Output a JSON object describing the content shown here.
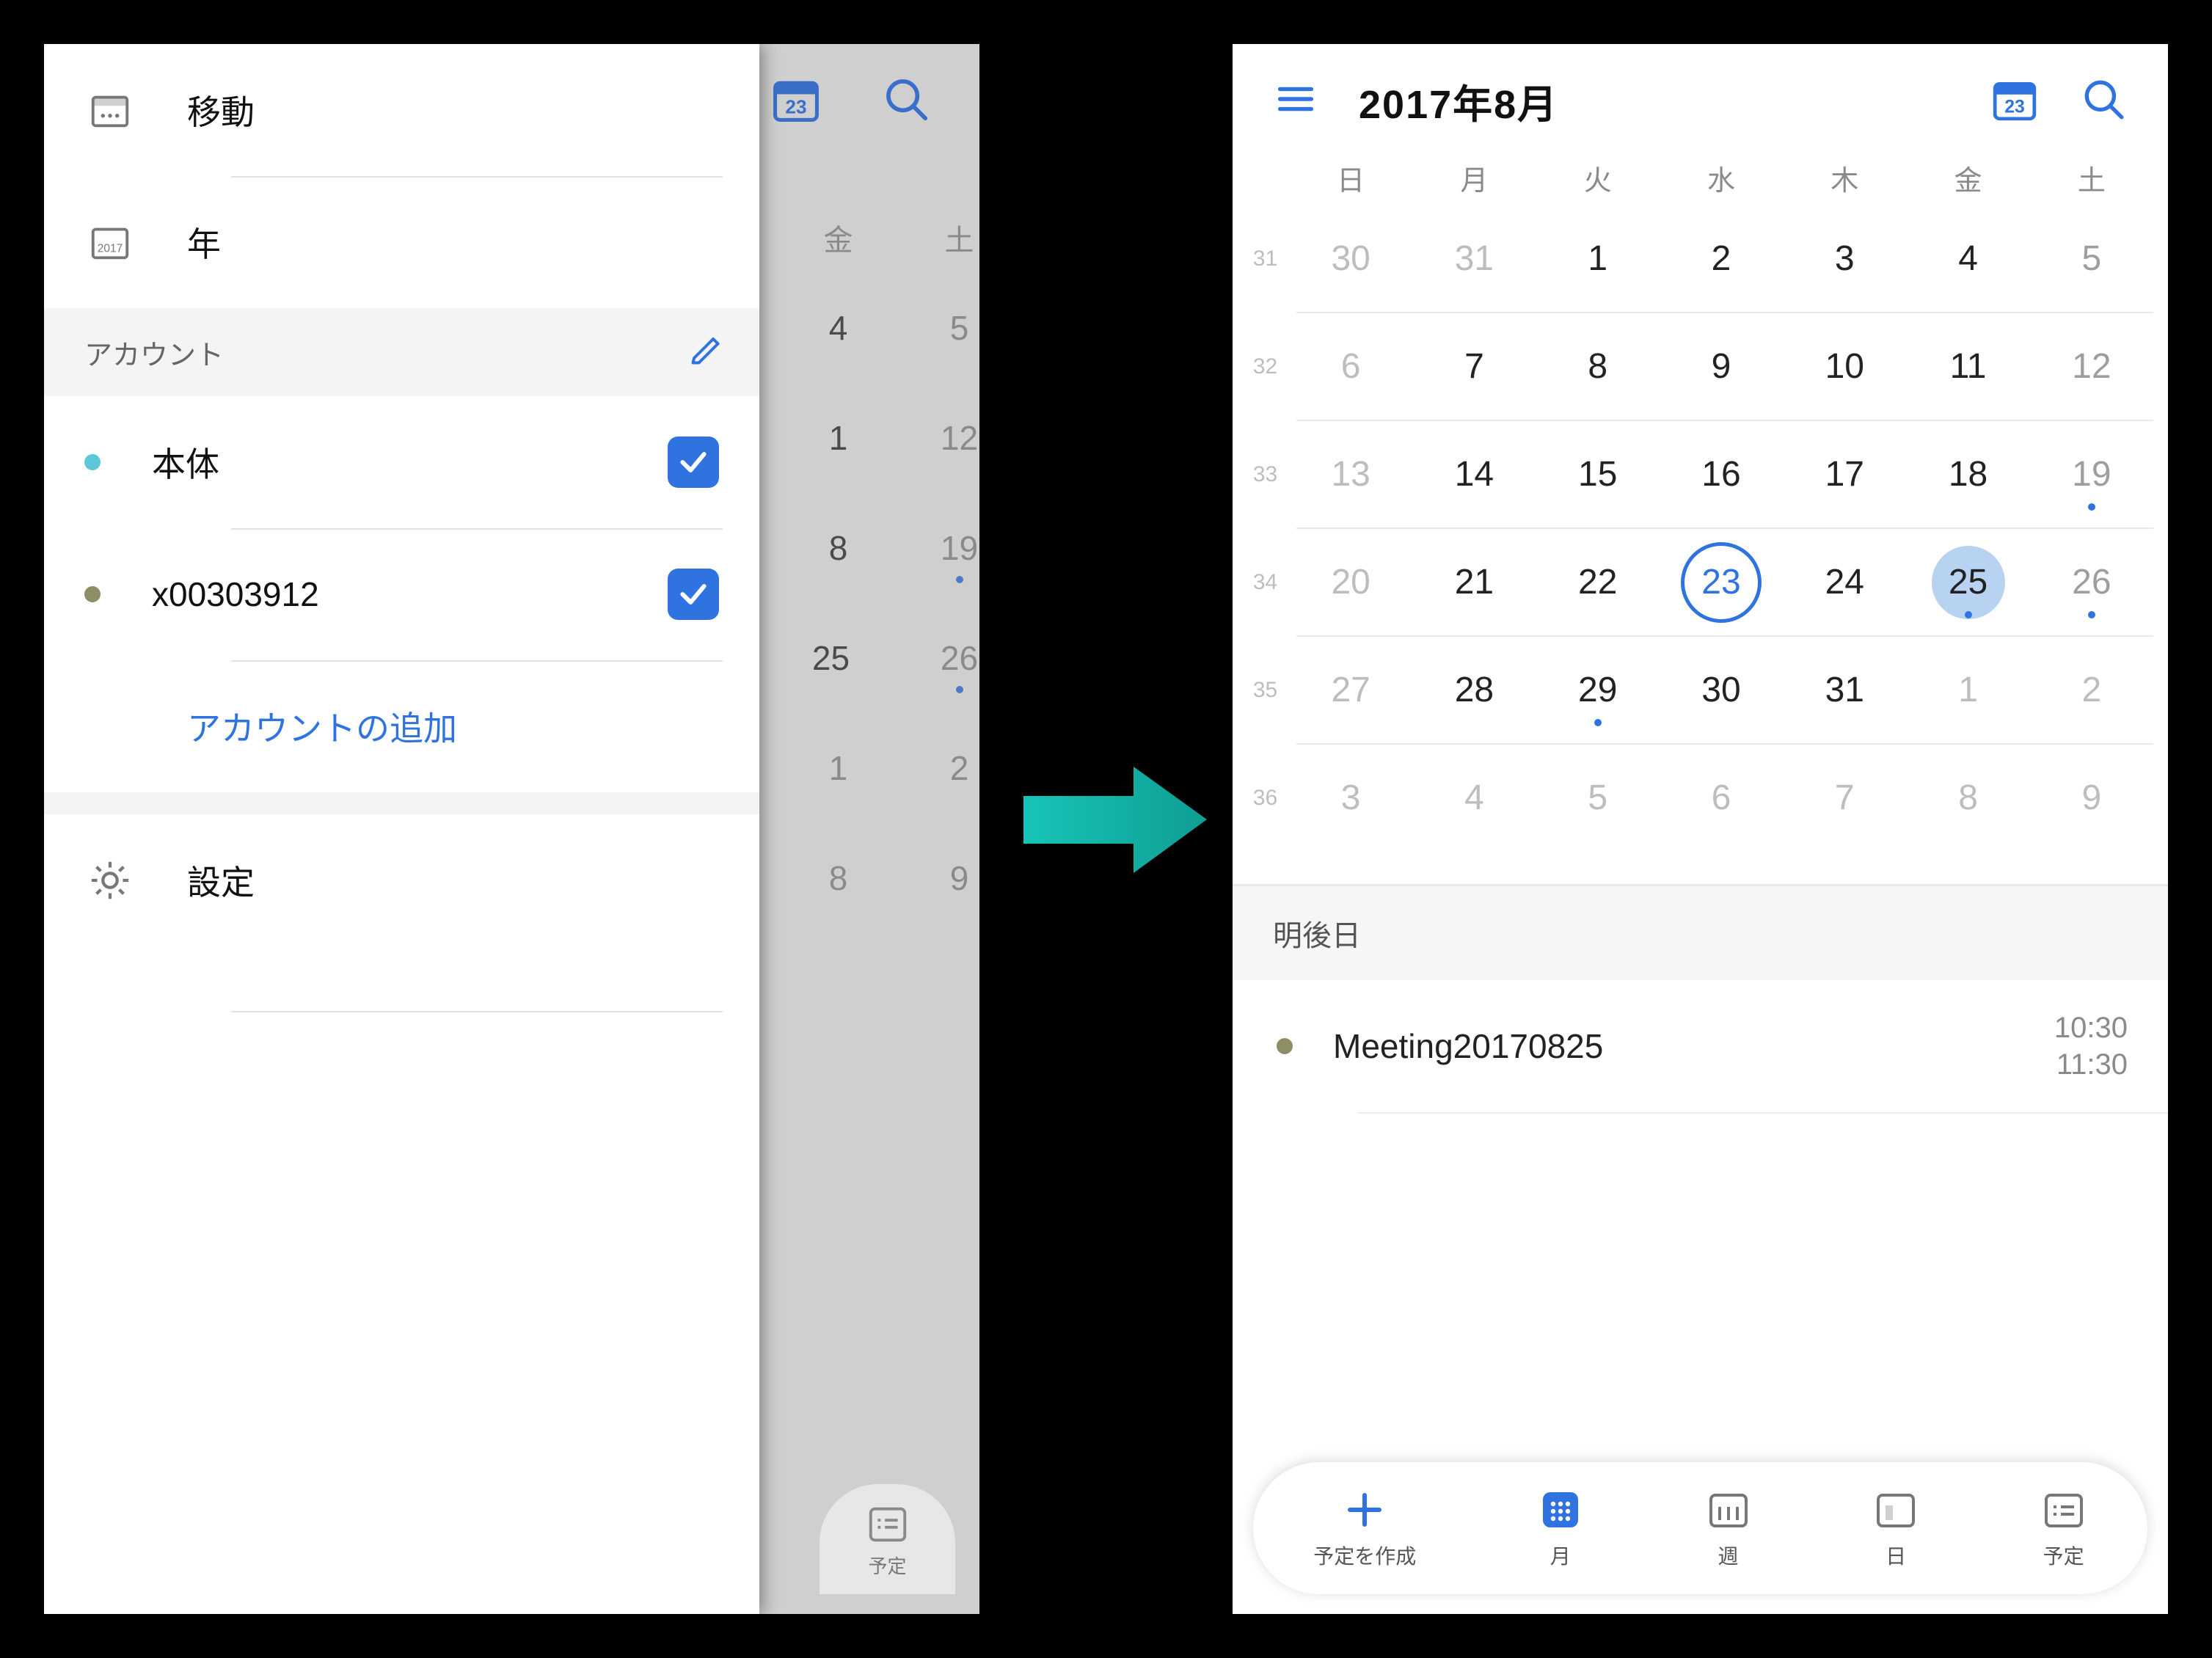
{
  "colors": {
    "accent": "#2f73e0",
    "muted": "#8a8a8a",
    "acc2": "#8d8d68",
    "acc3": "#5bc7d8"
  },
  "left": {
    "drawer": {
      "move": "移動",
      "year": "年",
      "accounts_header": "アカウント",
      "acct1": "本体",
      "acct2": "x00303912",
      "add_account": "アカウントの追加",
      "settings": "設定"
    },
    "underlay": {
      "fri": "金",
      "sat": "土",
      "cells": [
        {
          "fri": "4",
          "sat": "5"
        },
        {
          "fri": "1",
          "sat": "12"
        },
        {
          "fri": "8",
          "sat": "19",
          "dotSat": true
        },
        {
          "fri": "25",
          "sat": "26",
          "dotSat": true
        },
        {
          "fri": "1",
          "sat": "2"
        },
        {
          "fri": "8",
          "sat": "9"
        }
      ],
      "pill": "予定"
    }
  },
  "right": {
    "title": "2017年8月",
    "week_labels": [
      "日",
      "月",
      "火",
      "水",
      "木",
      "金",
      "土"
    ],
    "rows": [
      {
        "wk": "31",
        "d": [
          {
            "n": "30",
            "off": true
          },
          {
            "n": "31",
            "off": true
          },
          {
            "n": "1"
          },
          {
            "n": "2"
          },
          {
            "n": "3"
          },
          {
            "n": "4"
          },
          {
            "n": "5",
            "sat": true
          }
        ]
      },
      {
        "wk": "32",
        "d": [
          {
            "n": "6",
            "off": true
          },
          {
            "n": "7"
          },
          {
            "n": "8"
          },
          {
            "n": "9"
          },
          {
            "n": "10"
          },
          {
            "n": "11"
          },
          {
            "n": "12",
            "sat": true
          }
        ]
      },
      {
        "wk": "33",
        "d": [
          {
            "n": "13",
            "off": true
          },
          {
            "n": "14"
          },
          {
            "n": "15"
          },
          {
            "n": "16"
          },
          {
            "n": "17"
          },
          {
            "n": "18"
          },
          {
            "n": "19",
            "sat": true,
            "dot": true
          }
        ]
      },
      {
        "wk": "34",
        "d": [
          {
            "n": "20",
            "off": true
          },
          {
            "n": "21"
          },
          {
            "n": "22"
          },
          {
            "n": "23",
            "today": true
          },
          {
            "n": "24"
          },
          {
            "n": "25",
            "sel": true,
            "dot": true
          },
          {
            "n": "26",
            "sat": true,
            "dot": true
          }
        ]
      },
      {
        "wk": "35",
        "d": [
          {
            "n": "27",
            "off": true
          },
          {
            "n": "28"
          },
          {
            "n": "29",
            "dot": true
          },
          {
            "n": "30"
          },
          {
            "n": "31"
          },
          {
            "n": "1",
            "off": true
          },
          {
            "n": "2",
            "off": true
          }
        ]
      },
      {
        "wk": "36",
        "d": [
          {
            "n": "3",
            "off": true
          },
          {
            "n": "4",
            "off": true
          },
          {
            "n": "5",
            "off": true
          },
          {
            "n": "6",
            "off": true
          },
          {
            "n": "7",
            "off": true
          },
          {
            "n": "8",
            "off": true
          },
          {
            "n": "9",
            "off": true
          }
        ]
      }
    ],
    "agenda": {
      "header": "明後日",
      "event": {
        "title": "Meeting20170825",
        "start": "10:30",
        "end": "11:30"
      }
    },
    "bottom": {
      "new": "予定を作成",
      "month": "月",
      "week": "週",
      "day": "日",
      "list": "予定"
    }
  }
}
